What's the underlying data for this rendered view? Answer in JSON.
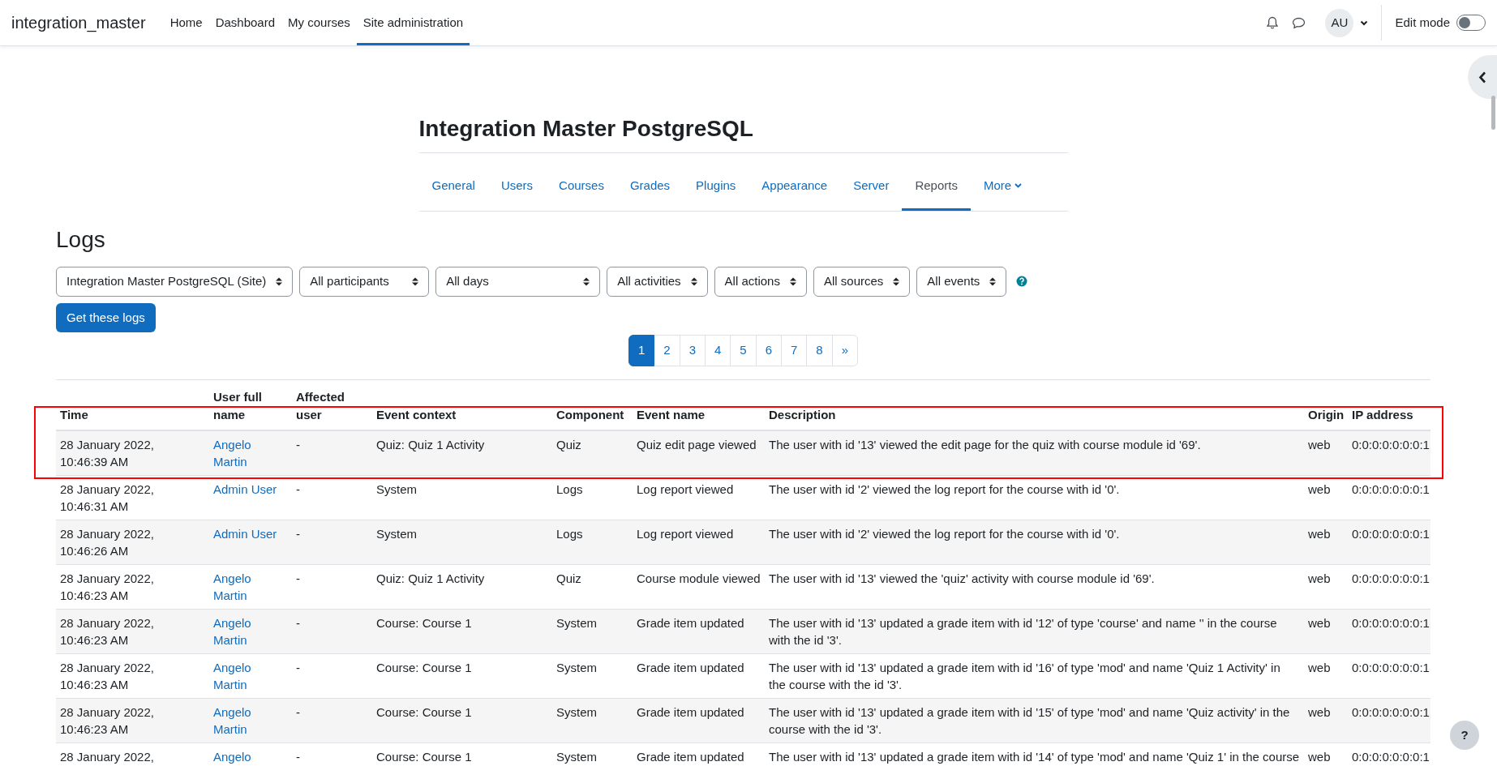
{
  "navbar": {
    "brand": "integration_master",
    "links": [
      {
        "label": "Home",
        "selected": false
      },
      {
        "label": "Dashboard",
        "selected": false
      },
      {
        "label": "My courses",
        "selected": false
      },
      {
        "label": "Site administration",
        "selected": true
      }
    ],
    "user_initials": "AU",
    "edit_mode": {
      "label": "Edit mode",
      "on": false
    }
  },
  "page_heading": "Integration Master PostgreSQL",
  "secondary_nav": [
    {
      "label": "General",
      "selected": false,
      "kind": "link"
    },
    {
      "label": "Users",
      "selected": false,
      "kind": "link"
    },
    {
      "label": "Courses",
      "selected": false,
      "kind": "link"
    },
    {
      "label": "Grades",
      "selected": false,
      "kind": "link"
    },
    {
      "label": "Plugins",
      "selected": false,
      "kind": "link"
    },
    {
      "label": "Appearance",
      "selected": false,
      "kind": "link"
    },
    {
      "label": "Server",
      "selected": false,
      "kind": "link"
    },
    {
      "label": "Reports",
      "selected": true,
      "kind": "link"
    },
    {
      "label": "More",
      "selected": false,
      "kind": "dropdown"
    }
  ],
  "section_title": "Logs",
  "filters": [
    {
      "value": "Integration Master PostgreSQL (Site)"
    },
    {
      "value": "All participants"
    },
    {
      "value": "All days"
    },
    {
      "value": "All activities"
    },
    {
      "value": "All actions"
    },
    {
      "value": "All sources"
    },
    {
      "value": "All events"
    }
  ],
  "submit_button": "Get these logs",
  "pagination": [
    {
      "label": "1",
      "selected": true
    },
    {
      "label": "2",
      "selected": false
    },
    {
      "label": "3",
      "selected": false
    },
    {
      "label": "4",
      "selected": false
    },
    {
      "label": "5",
      "selected": false
    },
    {
      "label": "6",
      "selected": false
    },
    {
      "label": "7",
      "selected": false
    },
    {
      "label": "8",
      "selected": false
    },
    {
      "label": "»",
      "selected": false
    }
  ],
  "table": {
    "columns": [
      "Time",
      "User full name",
      "Affected user",
      "Event context",
      "Component",
      "Event name",
      "Description",
      "Origin",
      "IP address"
    ],
    "rows": [
      {
        "time": "28 January 2022, 10:46:39 AM",
        "user": "Angelo Martin",
        "affected_user": "-",
        "event_context": "Quiz: Quiz 1 Activity",
        "component": "Quiz",
        "event_name": "Quiz edit page viewed",
        "description": "The user with id '13' viewed the edit page for the quiz with course module id '69'.",
        "origin": "web",
        "ip_address": "0:0:0:0:0:0:0:1"
      },
      {
        "time": "28 January 2022, 10:46:31 AM",
        "user": "Admin User",
        "affected_user": "-",
        "event_context": "System",
        "component": "Logs",
        "event_name": "Log report viewed",
        "description": "The user with id '2' viewed the log report for the course with id '0'.",
        "origin": "web",
        "ip_address": "0:0:0:0:0:0:0:1"
      },
      {
        "time": "28 January 2022, 10:46:26 AM",
        "user": "Admin User",
        "affected_user": "-",
        "event_context": "System",
        "component": "Logs",
        "event_name": "Log report viewed",
        "description": "The user with id '2' viewed the log report for the course with id '0'.",
        "origin": "web",
        "ip_address": "0:0:0:0:0:0:0:1"
      },
      {
        "time": "28 January 2022, 10:46:23 AM",
        "user": "Angelo Martin",
        "affected_user": "-",
        "event_context": "Quiz: Quiz 1 Activity",
        "component": "Quiz",
        "event_name": "Course module viewed",
        "description": "The user with id '13' viewed the 'quiz' activity with course module id '69'.",
        "origin": "web",
        "ip_address": "0:0:0:0:0:0:0:1"
      },
      {
        "time": "28 January 2022, 10:46:23 AM",
        "user": "Angelo Martin",
        "affected_user": "-",
        "event_context": "Course: Course 1",
        "component": "System",
        "event_name": "Grade item updated",
        "description": "The user with id '13' updated a grade item with id '12' of type 'course' and name '' in the course with the id '3'.",
        "origin": "web",
        "ip_address": "0:0:0:0:0:0:0:1"
      },
      {
        "time": "28 January 2022, 10:46:23 AM",
        "user": "Angelo Martin",
        "affected_user": "-",
        "event_context": "Course: Course 1",
        "component": "System",
        "event_name": "Grade item updated",
        "description": "The user with id '13' updated a grade item with id '16' of type 'mod' and name 'Quiz 1 Activity' in the course with the id '3'.",
        "origin": "web",
        "ip_address": "0:0:0:0:0:0:0:1"
      },
      {
        "time": "28 January 2022, 10:46:23 AM",
        "user": "Angelo Martin",
        "affected_user": "-",
        "event_context": "Course: Course 1",
        "component": "System",
        "event_name": "Grade item updated",
        "description": "The user with id '13' updated a grade item with id '15' of type 'mod' and name 'Quiz activity' in the course with the id '3'.",
        "origin": "web",
        "ip_address": "0:0:0:0:0:0:0:1"
      },
      {
        "time": "28 January 2022,",
        "user": "Angelo",
        "affected_user": "-",
        "event_context": "Course: Course 1",
        "component": "System",
        "event_name": "Grade item updated",
        "description": "The user with id '13' updated a grade item with id '14' of type 'mod' and name 'Quiz 1' in the course",
        "origin": "web",
        "ip_address": "0:0:0:0:0:0:0:1"
      }
    ]
  },
  "help_button": "?"
}
